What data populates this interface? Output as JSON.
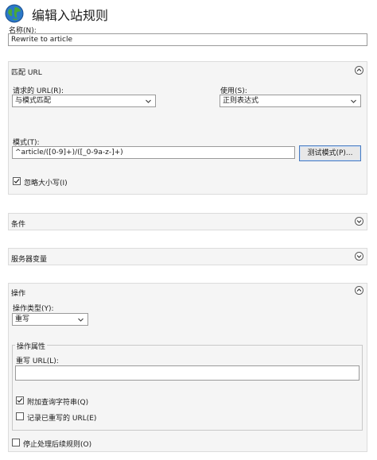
{
  "header": {
    "title": "编辑入站规则",
    "icon": "globe-icon"
  },
  "name": {
    "label": "名称(N):",
    "value": "Rewrite to article"
  },
  "match_url": {
    "heading": "匹配 URL",
    "requested_url_label": "请求的 URL(R):",
    "requested_url_value": "与模式匹配",
    "using_label": "使用(S):",
    "using_value": "正则表达式",
    "pattern_label": "模式(T):",
    "pattern_value": "^article/([0-9]+)/([_0-9a-z-]+)",
    "test_button": "测试模式(P)...",
    "ignore_case_label": "忽略大小写(I)",
    "ignore_case_checked": true
  },
  "conditions": {
    "heading": "条件"
  },
  "server_variables": {
    "heading": "服务器变量"
  },
  "action": {
    "heading": "操作",
    "type_label": "操作类型(Y):",
    "type_value": "重写",
    "properties_heading": "操作属性",
    "rewrite_url_label": "重写 URL(L):",
    "rewrite_url_value": "",
    "append_query_label": "附加查询字符串(Q)",
    "append_query_checked": true,
    "log_rewritten_label": "记录已重写的 URL(E)",
    "log_rewritten_checked": false,
    "stop_processing_label": "停止处理后续规则(O)",
    "stop_processing_checked": false
  }
}
